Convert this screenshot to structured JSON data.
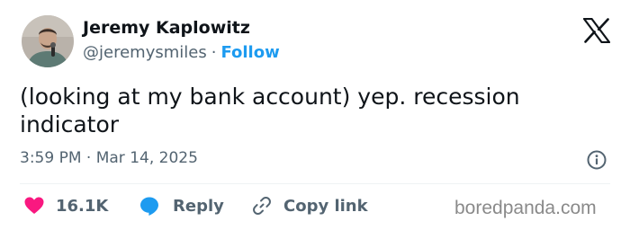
{
  "tweet": {
    "author": {
      "name": "Jeremy Kaplowitz",
      "handle": "@jeremysmiles",
      "separator": "·",
      "follow_label": "Follow"
    },
    "text": "(looking at my bank account) yep. recession indicator",
    "timestamp": "3:59 PM · Mar 14, 2025",
    "actions": {
      "like_count": "16.1K",
      "reply_label": "Reply",
      "copy_link_label": "Copy link"
    }
  },
  "watermark": "boredpanda.com",
  "icons": {
    "brand": "x-logo-icon",
    "info": "info-icon",
    "like": "heart-icon",
    "reply": "reply-bubble-icon",
    "copy": "link-icon"
  },
  "colors": {
    "text_primary": "#0f1419",
    "text_secondary": "#536471",
    "follow_blue": "#1d9bf0",
    "like_pink": "#f91880",
    "watermark_gray": "#8a8a8a"
  }
}
